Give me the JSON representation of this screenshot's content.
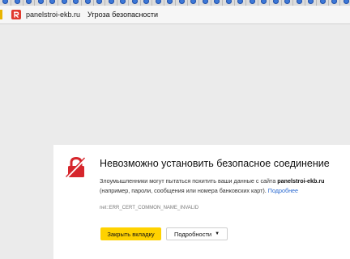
{
  "browser": {
    "url": "panelstroi-ekb.ru",
    "page_title": "Угроза безопасности",
    "colors": {
      "site_icon": "#e03a2f",
      "tab_favicon": "#3c78d8"
    }
  },
  "error": {
    "heading": "Невозможно установить безопасное соединение",
    "desc_prefix": "Злоумышленники могут пытаться похитить ваши данные с сайта ",
    "desc_site": "panelstroi-ekb.ru",
    "desc_suffix": "(например, пароли, сообщения или номера банковских карт). ",
    "more_link": "Подробнее",
    "code": "net::ERR_CERT_COMMON_NAME_INVALID",
    "close_button": "Закрыть вкладку",
    "details_button": "Подробности",
    "details_caret": "▼",
    "icon": "broken-lock-icon",
    "colors": {
      "icon": "#d6262c",
      "primary_button": "#ffd200",
      "link": "#2b6ad1"
    }
  }
}
